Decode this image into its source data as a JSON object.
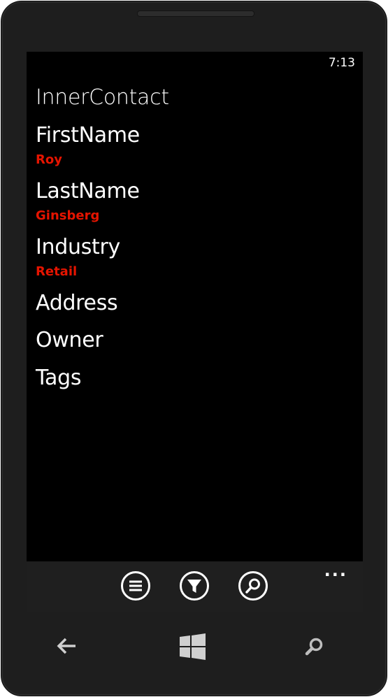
{
  "status_bar": {
    "time": "7:13"
  },
  "page": {
    "title": "InnerContact",
    "fields": [
      {
        "label": "FirstName",
        "value": "Roy"
      },
      {
        "label": "LastName",
        "value": "Ginsberg"
      },
      {
        "label": "Industry",
        "value": "Retail"
      },
      {
        "label": "Address"
      },
      {
        "label": "Owner"
      },
      {
        "label": "Tags"
      }
    ]
  },
  "app_bar": {
    "buttons": [
      "list-icon",
      "filter-icon",
      "search-icon"
    ],
    "more": "..."
  },
  "hardware_buttons": [
    "back-arrow-icon",
    "windows-start-icon",
    "search-icon"
  ],
  "colors": {
    "accent": "#e51400",
    "background": "#000000",
    "foreground": "#ffffff",
    "app_bar": "#1f1f1f"
  }
}
